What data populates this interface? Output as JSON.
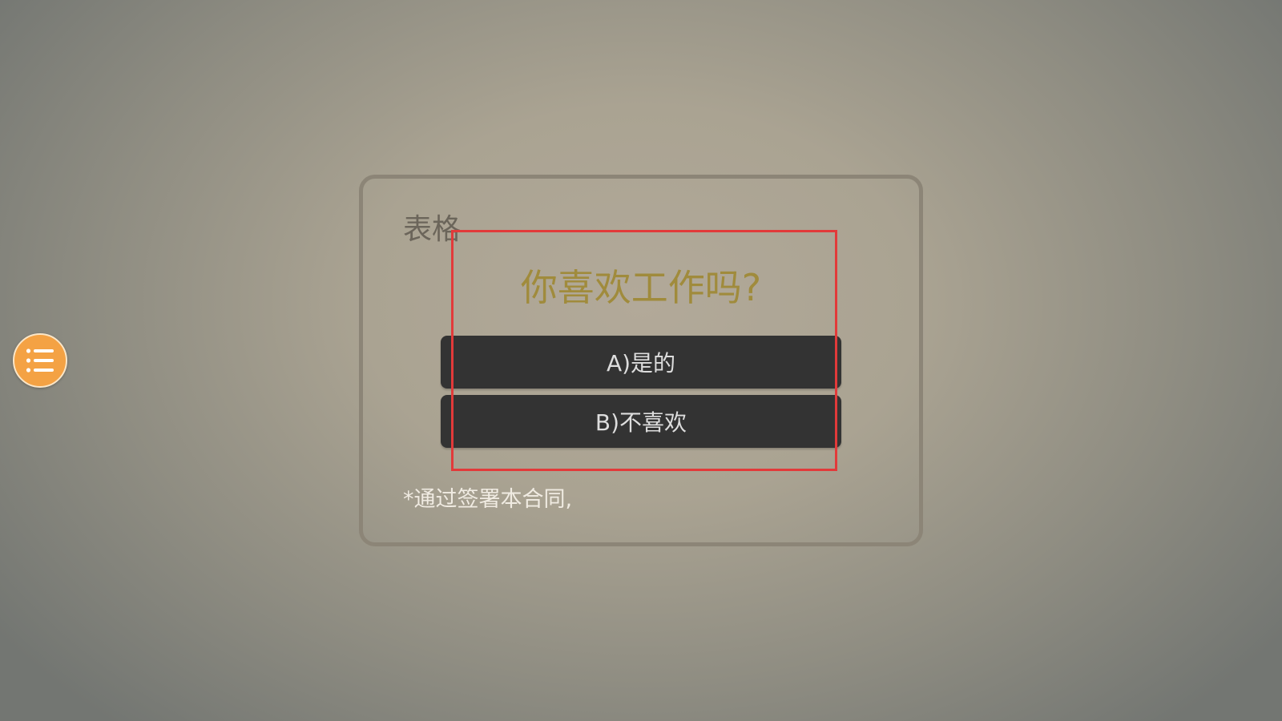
{
  "menu": {
    "icon": "list-icon",
    "color": "#f4a244"
  },
  "form": {
    "title": "表格",
    "question": "你喜欢工作吗?",
    "options": [
      {
        "label": "A)是的"
      },
      {
        "label": "B)不喜欢"
      }
    ],
    "footnote": "*通过签署本合同,"
  },
  "colors": {
    "question": "#a08b3c",
    "button": "#333333",
    "highlight": "#e23a3a"
  }
}
